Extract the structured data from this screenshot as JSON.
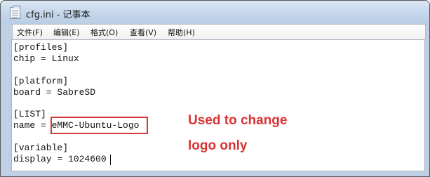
{
  "window": {
    "title": "cfg.ini - 记事本"
  },
  "menubar": {
    "items": [
      "文件(F)",
      "编辑(E)",
      "格式(O)",
      "查看(V)",
      "帮助(H)"
    ]
  },
  "editor": {
    "lines": [
      "[profiles]",
      "chip = Linux",
      "",
      "[platform]",
      "board = SabreSD",
      "",
      "[LIST]",
      "name = eMMC-Ubuntu-Logo",
      "",
      "[variable]",
      "display = 1024600"
    ],
    "highlighted_value": "eMMC-Ubuntu-Logo"
  },
  "annotation": {
    "line1": "Used to change",
    "line2": "logo only",
    "color": "#d93232"
  }
}
